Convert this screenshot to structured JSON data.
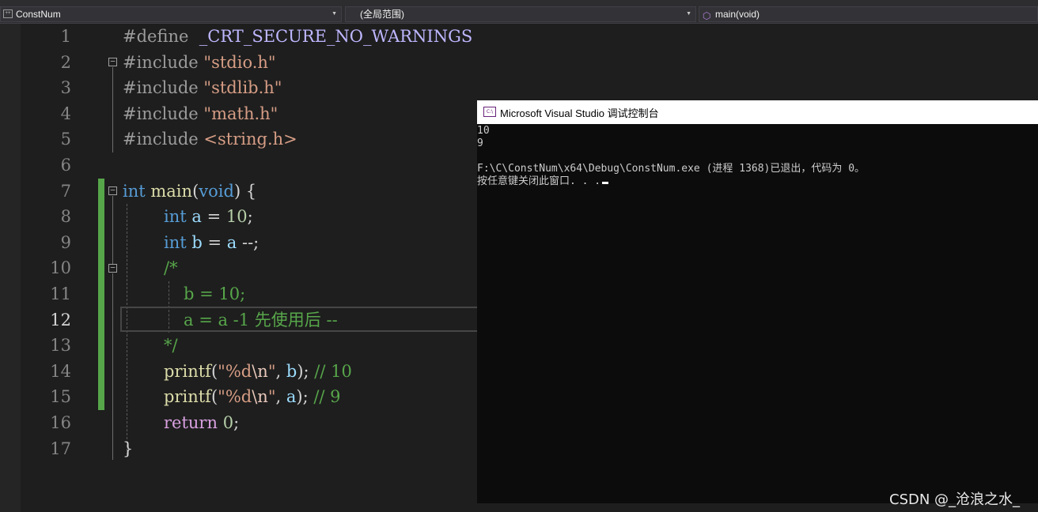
{
  "navbar": {
    "project": "ConstNum",
    "scope": "(全局范围)",
    "member": "main(void)",
    "project_icon": "cpp-project-icon",
    "member_icon": "cube-function-icon"
  },
  "editor": {
    "line_numbers": [
      "1",
      "2",
      "3",
      "4",
      "5",
      "6",
      "7",
      "8",
      "9",
      "10",
      "11",
      "12",
      "13",
      "14",
      "15",
      "16",
      "17"
    ],
    "current_line": 12,
    "code": {
      "l1": {
        "pp": "#define",
        "macro": "_CRT_SECURE_NO_WARNINGS"
      },
      "l2": {
        "pp": "#include",
        "str": "\"stdio.h\""
      },
      "l3": {
        "pp": "#include",
        "str": "\"stdlib.h\""
      },
      "l4": {
        "pp": "#include",
        "str": "\"math.h\""
      },
      "l5": {
        "pp": "#include",
        "str": "<string.h>"
      },
      "l7": {
        "kw1": "int",
        "fn": "main",
        "p1": "(",
        "kw2": "void",
        "p2": ") {"
      },
      "l8": {
        "kw": "int",
        "var": "a",
        "op": " = ",
        "num": "10",
        "end": ";"
      },
      "l9": {
        "kw": "int",
        "var": "b",
        "op": " = ",
        "var2": "a",
        "end": " --;"
      },
      "l10": {
        "cmt": "/*"
      },
      "l11": {
        "cmt": "b = 10;"
      },
      "l12": {
        "cmt": "a = a -1 先使用后 --"
      },
      "l13": {
        "cmt": "*/"
      },
      "l14": {
        "fn": "printf",
        "p1": "(",
        "s1": "\"",
        "fmt": "%d",
        "esc": "\\n",
        "s2": "\"",
        "mid": ", ",
        "var": "b",
        "end": "); ",
        "cmt": "// 10"
      },
      "l15": {
        "fn": "printf",
        "p1": "(",
        "s1": "\"",
        "fmt": "%d",
        "esc": "\\n",
        "s2": "\"",
        "mid": ", ",
        "var": "a",
        "end": "); ",
        "cmt": "// 9"
      },
      "l16": {
        "kw": "return",
        "num": "0",
        "end": ";"
      },
      "l17": {
        "brace": "}"
      }
    }
  },
  "console": {
    "title": "Microsoft Visual Studio 调试控制台",
    "icon": "console-app-icon",
    "lines": [
      "10",
      "9",
      "",
      "F:\\C\\ConstNum\\x64\\Debug\\ConstNum.exe (进程 1368)已退出，代码为 0。",
      "按任意键关闭此窗口. . ."
    ]
  },
  "watermark": "CSDN @_沧浪之水_"
}
